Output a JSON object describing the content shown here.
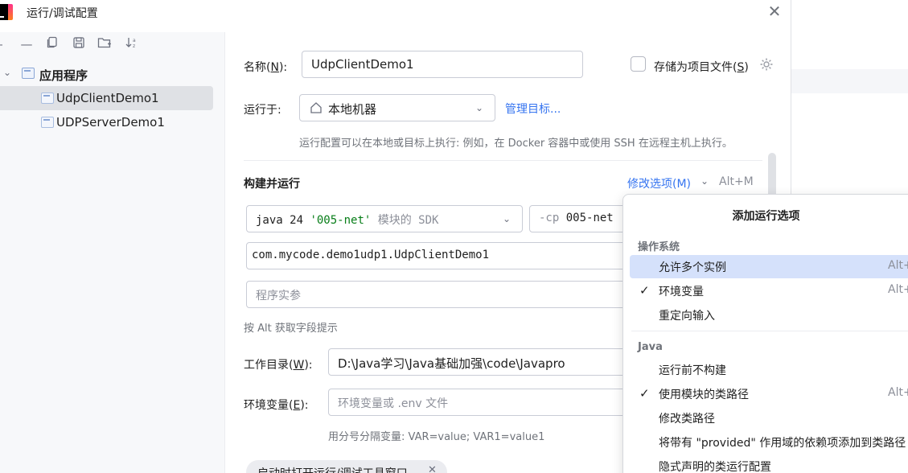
{
  "window": {
    "title": "运行/调试配置",
    "close_glyph": "✕"
  },
  "toolbar": {
    "icons": [
      "add-icon",
      "remove-icon",
      "copy-icon",
      "save-icon",
      "folder-icon",
      "sort-icon"
    ]
  },
  "tree": {
    "group_label": "应用程序",
    "items": [
      {
        "label": "UdpClientDemo1",
        "selected": true
      },
      {
        "label": "UDPServerDemo1",
        "selected": false
      }
    ]
  },
  "form": {
    "name_label": "名称(",
    "name_mnemonic": "N",
    "name_label_end": "):",
    "name_value": "UdpClientDemo1",
    "store_label": "存储为项目文件(",
    "store_mnemonic": "S",
    "store_label_end": ")",
    "run_on_label": "运行于:",
    "run_on_value": "本地机器",
    "manage_targets": "管理目标...",
    "run_on_hint": "运行配置可以在本地或目标上执行: 例如，在 Docker 容器中或使用 SSH 在远程主机上执行。",
    "build_run_title": "构建并运行",
    "modify_options": "修改选项(M)",
    "modify_shortcut": "Alt+M",
    "sdk_value": "java 24",
    "sdk_module": "'005-net'",
    "sdk_suffix": "模块的 SDK",
    "cp_flag": "-cp",
    "cp_value": "005-net",
    "main_class": "com.mycode.demo1udp1.UdpClientDemo1",
    "program_args_placeholder": "程序实参",
    "alt_hint": "按 Alt 获取字段提示",
    "workdir_label": "工作目录(",
    "workdir_mnemonic": "W",
    "workdir_label_end": "):",
    "workdir_value": "D:\\Java学习\\Java基础加强\\code\\Javapro",
    "env_label": "环境变量(",
    "env_mnemonic": "E",
    "env_label_end": "):",
    "env_placeholder": "环境变量或 .env 文件",
    "env_hint": "用分号分隔变量: VAR=value; VAR1=value1",
    "bottom_chip": "启动时打开运行/调试工具窗口",
    "bottom_chip_close": "✕"
  },
  "popup": {
    "title": "添加运行选项",
    "groups": [
      {
        "label": "操作系统",
        "items": [
          {
            "label": "允许多个实例",
            "shortcut": "Alt+U",
            "checked": false,
            "hover": true
          },
          {
            "label": "环境变量",
            "shortcut": "Alt+E",
            "checked": true,
            "hover": false
          },
          {
            "label": "重定向输入",
            "shortcut": "",
            "checked": false,
            "hover": false
          }
        ]
      },
      {
        "label": "Java",
        "items": [
          {
            "label": "运行前不构建",
            "shortcut": "",
            "checked": false,
            "hover": false
          },
          {
            "label": "使用模块的类路径",
            "shortcut": "Alt+O",
            "checked": true,
            "hover": false
          },
          {
            "label": "修改类路径",
            "shortcut": "",
            "checked": false,
            "hover": false
          },
          {
            "label": "将带有 \"provided\" 作用域的依赖项添加到类路径",
            "shortcut": "",
            "checked": false,
            "hover": false
          },
          {
            "label": "隐式声明的类运行配置",
            "shortcut": "",
            "checked": false,
            "hover": false
          }
        ]
      }
    ],
    "check_glyph": "✓"
  }
}
